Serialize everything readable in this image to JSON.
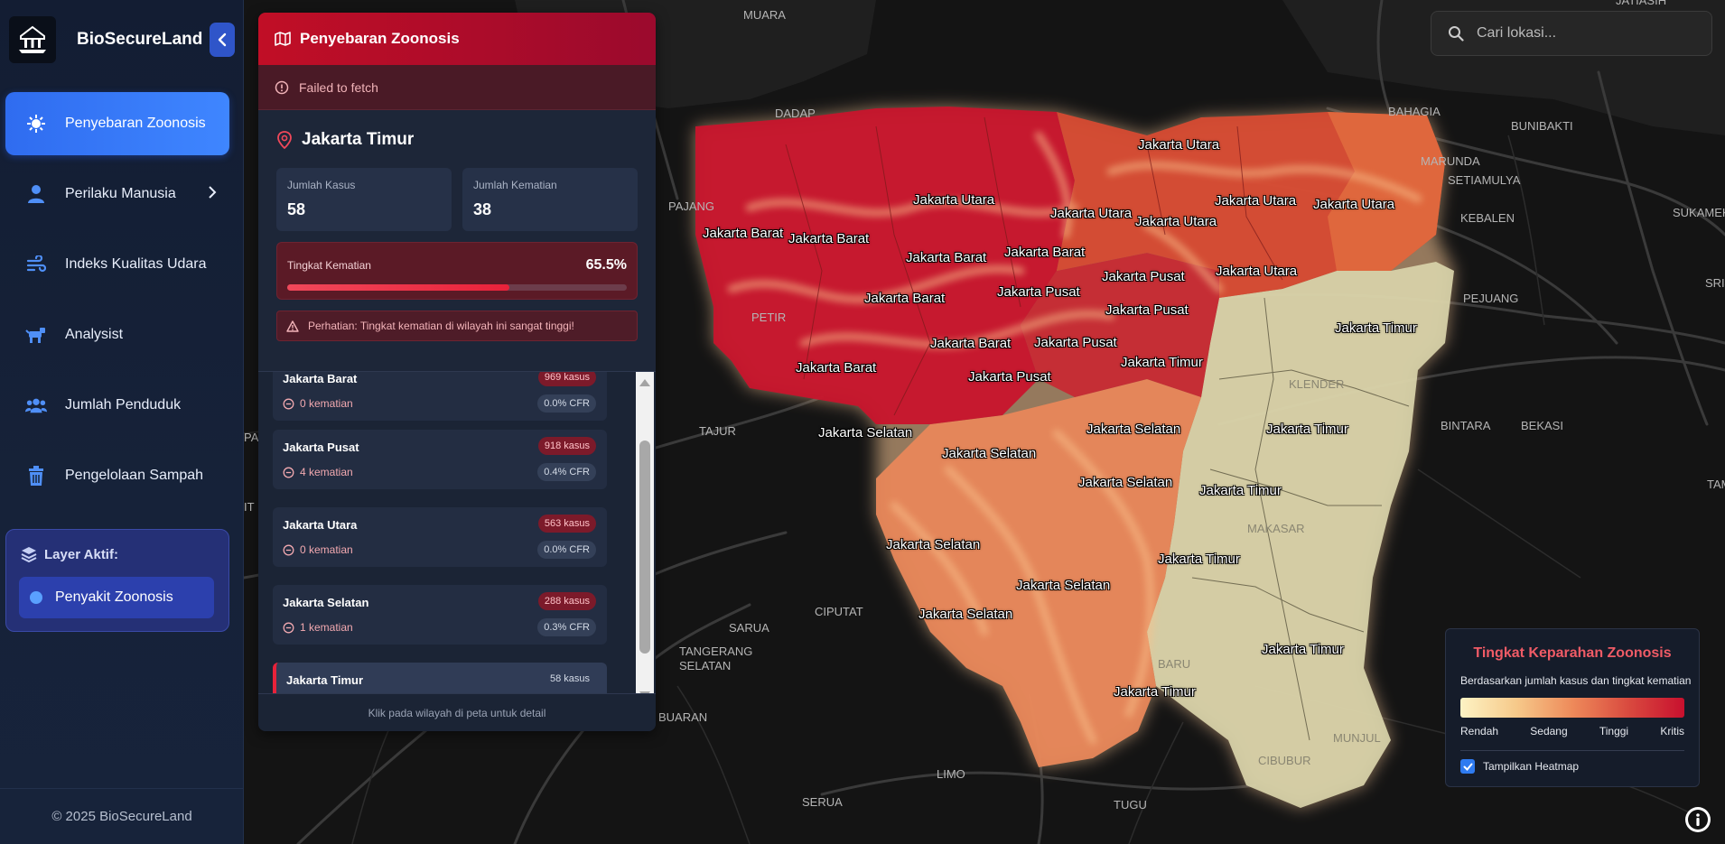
{
  "app": {
    "name": "BioSecureLand"
  },
  "sidebar": {
    "items": [
      {
        "label": "Penyebaran Zoonosis"
      },
      {
        "label": "Perilaku Manusia"
      },
      {
        "label": "Indeks Kualitas Udara"
      },
      {
        "label": "Analysist"
      },
      {
        "label": "Jumlah Penduduk"
      },
      {
        "label": "Pengelolaan Sampah"
      }
    ],
    "layer": {
      "title": "Layer Aktif:",
      "active": "Penyakit Zoonosis"
    },
    "footer": "© 2025 BioSecureLand"
  },
  "panel": {
    "title": "Penyebaran Zoonosis",
    "error": "Failed to fetch",
    "detail": {
      "region": "Jakarta Timur",
      "cases_label": "Jumlah Kasus",
      "cases": "58",
      "deaths_label": "Jumlah Kematian",
      "deaths": "38",
      "mortality_label": "Tingkat Kematian",
      "mortality": "65.5%",
      "mortality_fraction": 0.655,
      "warning": "Perhatian: Tingkat kematian di wilayah ini sangat tinggi!"
    },
    "regions": [
      {
        "name": "Jakarta Barat",
        "cases": "969 kasus",
        "deaths": "0 kematian",
        "cfr": "0.0% CFR"
      },
      {
        "name": "Jakarta Pusat",
        "cases": "918 kasus",
        "deaths": "4 kematian",
        "cfr": "0.4% CFR"
      },
      {
        "name": "Jakarta Utara",
        "cases": "563 kasus",
        "deaths": "0 kematian",
        "cfr": "0.0% CFR"
      },
      {
        "name": "Jakarta Selatan",
        "cases": "288 kasus",
        "deaths": "1 kematian",
        "cfr": "0.3% CFR"
      },
      {
        "name": "Jakarta Timur",
        "cases": "58 kasus",
        "deaths": "",
        "cfr": ""
      }
    ],
    "footer": "Klik pada wilayah di peta untuk detail"
  },
  "search": {
    "placeholder": "Cari lokasi..."
  },
  "legend": {
    "title": "Tingkat Keparahan Zoonosis",
    "subtitle": "Berdasarkan jumlah kasus dan tingkat kematian",
    "ticks": [
      "Rendah",
      "Sedang",
      "Tinggi",
      "Kritis"
    ],
    "heatmap_label": "Tampilkan Heatmap",
    "heatmap_checked": true
  },
  "map": {
    "places": [
      {
        "name": "MUARA"
      },
      {
        "name": "DADAP"
      },
      {
        "name": "PAJANG"
      },
      {
        "name": "PETIR"
      },
      {
        "name": "TAJUR"
      },
      {
        "name": "CIPUTAT"
      },
      {
        "name": "SARUA"
      },
      {
        "name": "TANGERANG SELATAN"
      },
      {
        "name": "BUARAN"
      },
      {
        "name": "LIMO"
      },
      {
        "name": "SERUA"
      },
      {
        "name": "TUGU"
      },
      {
        "name": "BAHAGIA"
      },
      {
        "name": "BUNIBAKTI"
      },
      {
        "name": "MARUNDA"
      },
      {
        "name": "SETIAMULYA"
      },
      {
        "name": "KEBALEN"
      },
      {
        "name": "SUKAMEK"
      },
      {
        "name": "PEJUANG"
      },
      {
        "name": "SRIJ"
      },
      {
        "name": "BINTARA"
      },
      {
        "name": "BEKASI"
      },
      {
        "name": "TAM"
      },
      {
        "name": "KLENDER"
      },
      {
        "name": "MAKASAR"
      },
      {
        "name": "BARU"
      },
      {
        "name": "MUNJUL"
      },
      {
        "name": "CIBUBUR"
      },
      {
        "name": "JATIASIH"
      },
      {
        "name": "PA"
      },
      {
        "name": "IT"
      }
    ],
    "region_labels": [
      {
        "text": "Jakarta Utara"
      },
      {
        "text": "Jakarta Utara"
      },
      {
        "text": "Jakarta Utara"
      },
      {
        "text": "Jakarta Utara"
      },
      {
        "text": "Jakarta Utara"
      },
      {
        "text": "Jakarta Utara"
      },
      {
        "text": "Jakarta Utara"
      },
      {
        "text": "Jakarta Barat"
      },
      {
        "text": "Jakarta Barat"
      },
      {
        "text": "Jakarta Barat"
      },
      {
        "text": "Jakarta Barat"
      },
      {
        "text": "Jakarta Barat"
      },
      {
        "text": "Jakarta Barat"
      },
      {
        "text": "Jakarta Barat"
      },
      {
        "text": "Jakarta Pusat"
      },
      {
        "text": "Jakarta Pusat"
      },
      {
        "text": "Jakarta Pusat"
      },
      {
        "text": "Jakarta Pusat"
      },
      {
        "text": "Jakarta Pusat"
      },
      {
        "text": "Jakarta Timur"
      },
      {
        "text": "Jakarta Timur"
      },
      {
        "text": "Jakarta Timur"
      },
      {
        "text": "Jakarta Timur"
      },
      {
        "text": "Jakarta Timur"
      },
      {
        "text": "Jakarta Timur"
      },
      {
        "text": "Jakarta Timur"
      },
      {
        "text": "Jakarta Selatan"
      },
      {
        "text": "Jakarta Selatan"
      },
      {
        "text": "Jakarta Selatan"
      },
      {
        "text": "Jakarta Selatan"
      },
      {
        "text": "Jakarta Selatan"
      },
      {
        "text": "Jakarta Selatan"
      },
      {
        "text": "Jakarta Selatan"
      }
    ]
  }
}
